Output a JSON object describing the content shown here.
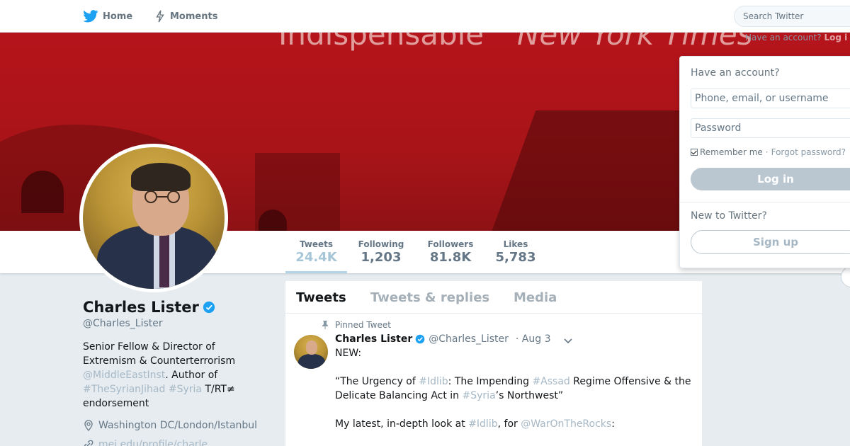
{
  "nav": {
    "home_label": "Home",
    "moments_label": "Moments",
    "search_placeholder": "Search Twitter"
  },
  "banner": {
    "text_left": "Indispensable",
    "text_right": "New York Times",
    "have_account_prefix": "Have an account?",
    "have_account_link": "Log i"
  },
  "stats": [
    {
      "label": "Tweets",
      "value": "24.4K"
    },
    {
      "label": "Following",
      "value": "1,203"
    },
    {
      "label": "Followers",
      "value": "81.8K"
    },
    {
      "label": "Likes",
      "value": "5,783"
    }
  ],
  "profile": {
    "name": "Charles Lister",
    "handle": "@Charles_Lister",
    "bio_part1": "Senior Fellow & Director of Extremism & Counterterrorism ",
    "bio_link1": "@MiddleEastInst",
    "bio_part2": ". Author of ",
    "bio_link2": "#TheSyrianJihad",
    "bio_part3": " ",
    "bio_link3": "#Syria",
    "bio_part4": " T/RT≠ endorsement",
    "location": "Washington DC/London/Istanbul",
    "url": "mei.edu/profile/charle..."
  },
  "timeline": {
    "tabs": [
      "Tweets",
      "Tweets & replies",
      "Media"
    ],
    "pinned_label": "Pinned Tweet",
    "tweet": {
      "name": "Charles Lister",
      "handle": "@Charles_Lister",
      "date": "· Aug 3",
      "line1": "NEW:",
      "p2_a": "“The Urgency of ",
      "p2_tag1": "#Idlib",
      "p2_b": ": The Impending ",
      "p2_tag2": "#Assad",
      "p2_c": " Regime Offensive & the Delicate Balancing Act in ",
      "p2_tag3": "#Syria",
      "p2_d": "’s Northwest”",
      "p3_a": "My latest, in-depth look at ",
      "p3_tag1": "#Idlib",
      "p3_b": ", for ",
      "p3_tag2": "@WarOnTheRocks",
      "p3_c": ":"
    }
  },
  "login": {
    "title": "Have an account?",
    "username_placeholder": "Phone, email, or username",
    "password_placeholder": "Password",
    "remember_label": "Remember me",
    "separator": "·",
    "forgot_label": "Forgot password?",
    "login_button": "Log in",
    "new_title": "New to Twitter?",
    "signup_button": "Sign up"
  },
  "colors": {
    "accent": "#1da1f2",
    "verified": "#1da1f2",
    "banner_red": "#b5141b"
  }
}
